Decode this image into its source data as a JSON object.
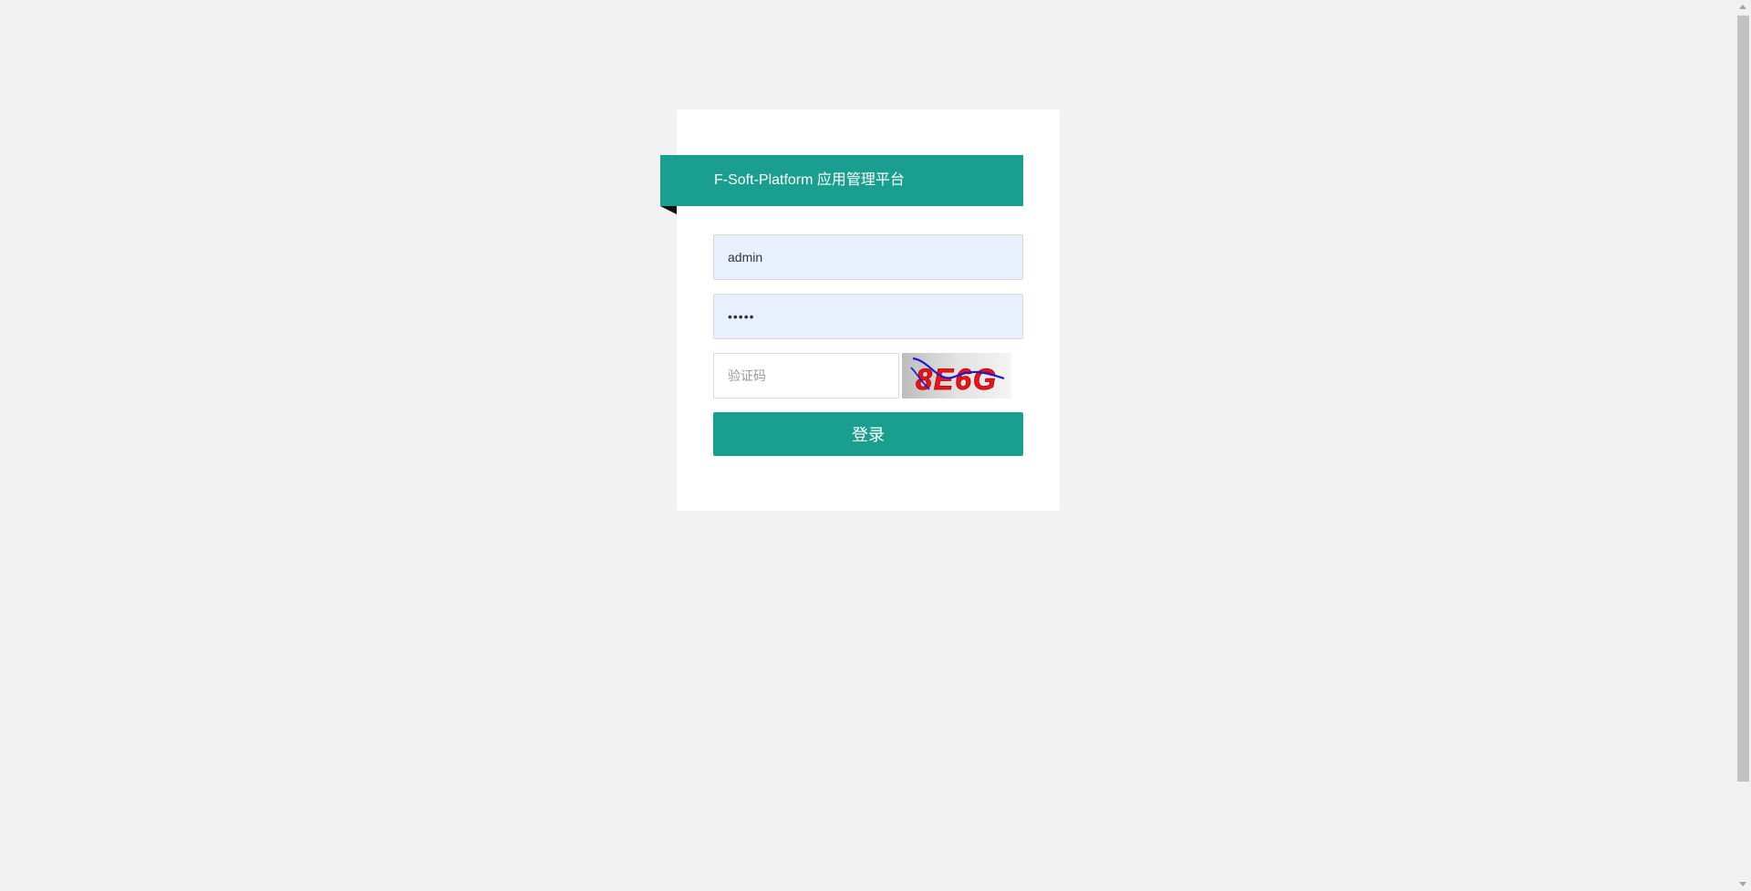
{
  "login": {
    "title": "F-Soft-Platform 应用管理平台",
    "username_value": "admin",
    "password_value": "admin",
    "captcha_placeholder": "验证码",
    "captcha_text": "8E6G",
    "login_label": "登录"
  },
  "colors": {
    "accent": "#1a9e8f",
    "page_background": "#f2f2f2",
    "autofill_background": "#e8f0fe",
    "captcha_text": "#e8141a",
    "captcha_strike": "#1a1ad0"
  },
  "icons": {
    "scroll_up": "triangle-up-icon",
    "scroll_down": "triangle-down-icon"
  }
}
